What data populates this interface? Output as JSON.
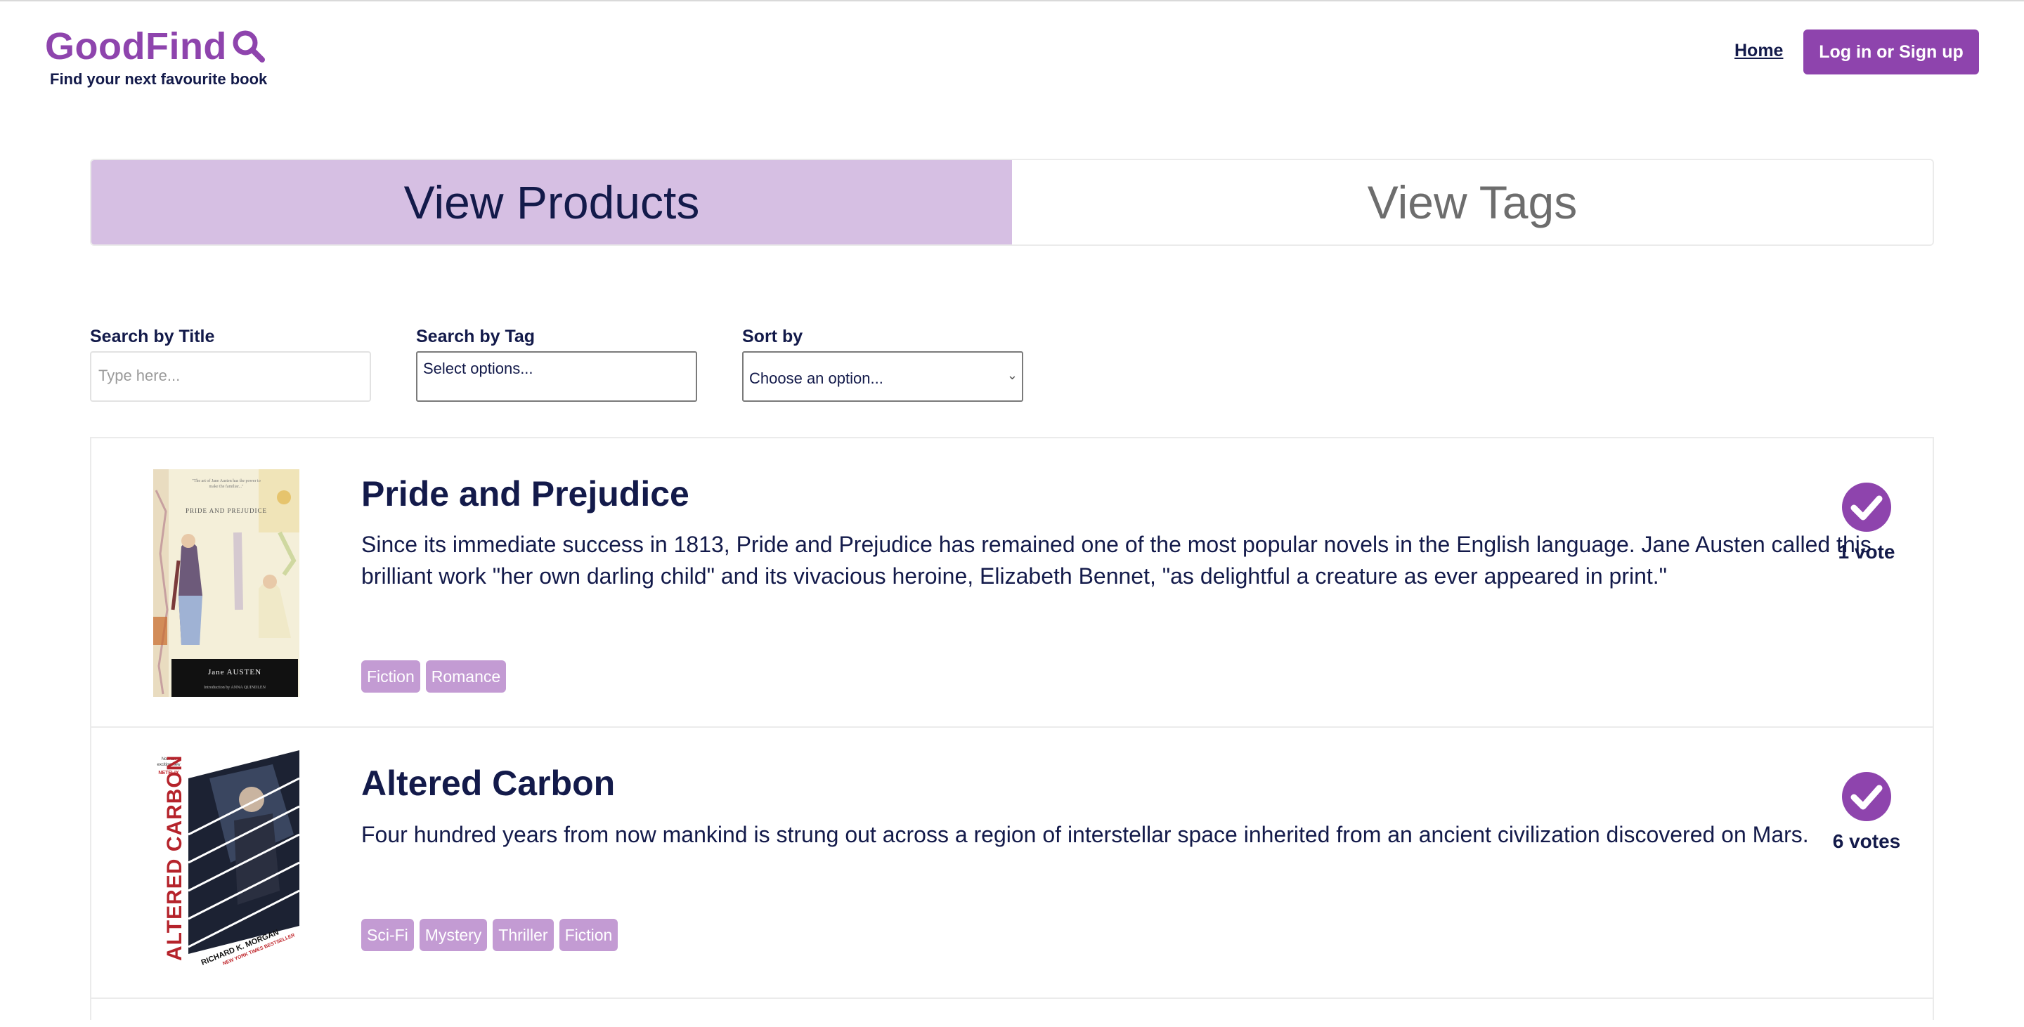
{
  "header": {
    "logo_text": "GoodFind",
    "logo_icon": "search-icon",
    "tagline": "Find your next favourite book",
    "nav_home": "Home",
    "login_button": "Log in or Sign up"
  },
  "tabs": {
    "products": "View Products",
    "tags": "View Tags",
    "active": "products"
  },
  "filters": {
    "title_label": "Search by Title",
    "title_placeholder": "Type here...",
    "tag_label": "Search by Tag",
    "tag_value": "Select options...",
    "sort_label": "Sort by",
    "sort_value": "Choose an option..."
  },
  "products": [
    {
      "title": "Pride and Prejudice",
      "description": "Since its immediate success in 1813, Pride and Prejudice has remained one of the most popular novels in the English language. Jane Austen called this brilliant work \"her own darling child\" and its vivacious heroine, Elizabeth Bennet, \"as delightful a creature as ever appeared in print.\"",
      "tags": [
        "Fiction",
        "Romance"
      ],
      "votes": "1 vote",
      "cover": {
        "title": "PRIDE AND PREJUDICE",
        "author": "Jane AUSTEN"
      }
    },
    {
      "title": "Altered Carbon",
      "description": "Four hundred years from now mankind is strung out across a region of interstellar space inherited from an ancient civilization discovered on Mars.",
      "tags": [
        "Sci-Fi",
        "Mystery",
        "Thriller",
        "Fiction"
      ],
      "votes": "6 votes",
      "cover": {
        "title": "ALTERED CARBON",
        "author": "RICHARD K. MORGAN",
        "badge": "NETFLIX",
        "ribbon": "NEW YORK TIMES BESTSELLER"
      }
    }
  ],
  "colors": {
    "brand": "#8e44ad",
    "tab_active": "#d6bfe3",
    "tag": "#c39bd3",
    "text": "#131a4a"
  }
}
